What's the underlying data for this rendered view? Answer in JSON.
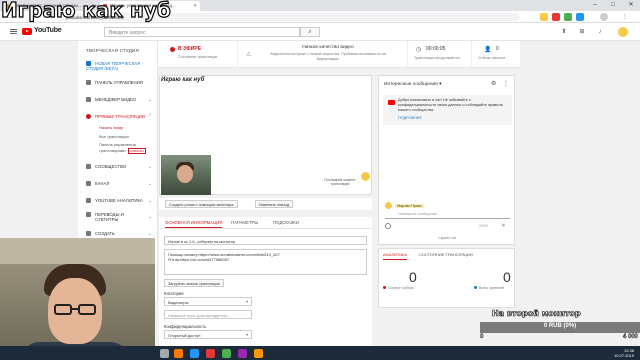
{
  "overlay": {
    "title": "Играю как нуб"
  },
  "browser": {
    "tabs": [
      {
        "title": "DonationAlerts: начинай стримы..."
      },
      {
        "title": "Панель управления трансляц..."
      }
    ],
    "url": "youtube.com/live_dashboard"
  },
  "youtube": {
    "logo_text": "YouTube",
    "search_placeholder": "Введите запрос"
  },
  "sidebar": {
    "title": "ТВОРЧЕСКАЯ СТУДИЯ",
    "new_studio": "НОВАЯ ТВОРЧЕСКАЯ СТУДИЯ (БЕТА)",
    "dashboard": "ПАНЕЛЬ УПРАВЛЕНИЯ",
    "video_manager": "МЕНЕДЖЕР ВИДЕО",
    "live": "ПРЯМЫЕ ТРАНСЛЯЦИИ",
    "live_sub": [
      "Начать эфир",
      "Все трансляции",
      "Панель управления трансляциями"
    ],
    "new_badge": "НОВИНКА",
    "community": "СООБЩЕСТВО",
    "channel": "КАНАЛ",
    "analytics": "YOUTUBE АНАЛИТИКА",
    "translations": "ПЕРЕВОДЫ И СУБТИТРЫ",
    "create": "СОЗДАТЬ"
  },
  "status": {
    "on_air": "В ЭФИРЕ",
    "on_air_sub": "Состояние трансляции",
    "quality_title": "Низкое качество видео",
    "quality_desc": "Видеопоток поступает с низкой скоростью. Проблемы возникают из-за буферизации.",
    "duration": "00:00:05",
    "duration_label": "Трансляция продолжается",
    "viewers": "0",
    "viewers_label": "Сейчас смотрят"
  },
  "player": {
    "title": "Играю как нуб",
    "note": "Последний момент трансляции",
    "btn_create_clip": "Создать ролик с помощью монитора",
    "btn_change": "Изменить эпизод"
  },
  "info": {
    "tabs": [
      "ОСНОВНАЯ ИНФОРМАЦИЯ",
      "ПАРАМЕТРЫ",
      "ПОДСКАЗКИ"
    ],
    "title_value": "Играю в кс 1.6, соберем на монитор",
    "desc_line1": "Помощь каналу:https://www.donationalerts.com/r/lilek513_627",
    "desc_line2": "Я в вк:https://vk.com/id477988057",
    "upload_btn": "Загрузить значок трансляции",
    "category_label": "Категория",
    "category_value": "Видеоигры",
    "game_placeholder": "Название игры (рекомендуется)",
    "privacy_label": "Конфиденциальность",
    "privacy_value": "Открытый доступ"
  },
  "chat": {
    "header": "Интересные сообщения",
    "welcome": "Добро пожаловать в чат! Не забывайте о конфиденциальности своих данных и соблюдайте правила нашего сообщества.",
    "learn_more": "ПОДРОБНЕЕ",
    "user": "Мартин Прикс",
    "placeholder": "Напишите сообщение...",
    "counter": "0/200",
    "hide": "Скрыть чат"
  },
  "analytics": {
    "tabs": [
      "АНАЛИТИКА",
      "СОСТОЯНИЕ ТРАНСЛЯЦИИ"
    ],
    "left_value": "0",
    "left_label": "Смотрят сейчас",
    "right_value": "0",
    "right_label": "Всего зрителей"
  },
  "donation": {
    "title": "На второй монитор",
    "amount": "0 RUB (0%)",
    "progress_percent": 0,
    "min": "0",
    "max": "4 000"
  },
  "taskbar": {
    "time": "12:38",
    "date": "10.07.2019"
  },
  "colors": {
    "youtube_red": "#ff0000",
    "studio_red": "#cc181e",
    "link_blue": "#167ac6"
  }
}
